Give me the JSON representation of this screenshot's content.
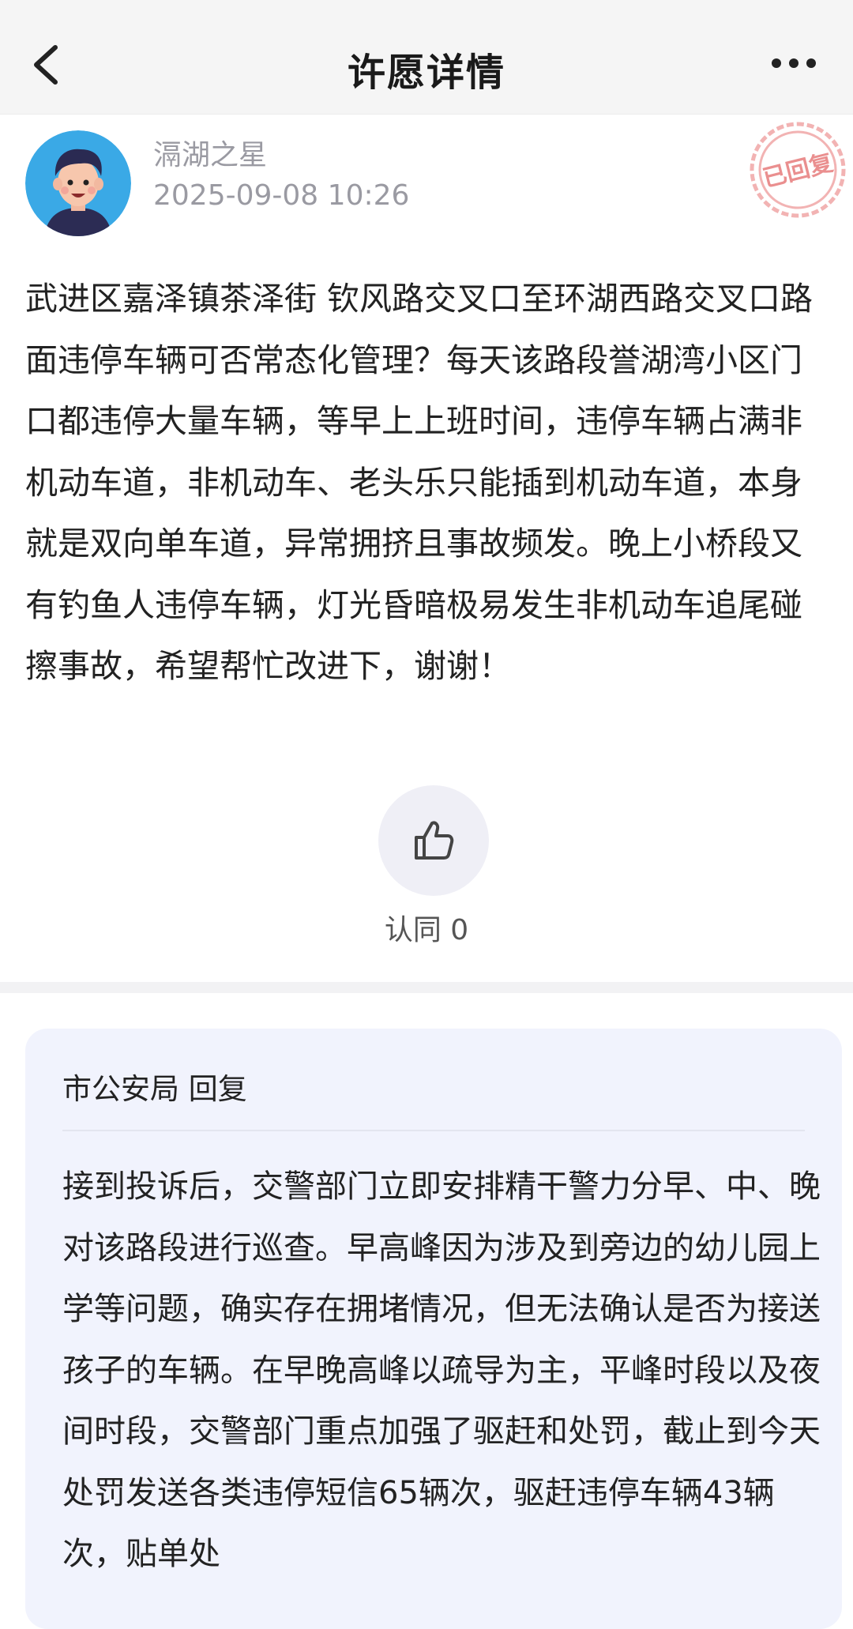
{
  "nav": {
    "title": "许愿详情",
    "back_icon": "chevron-left-icon",
    "more_icon": "more-horizontal-icon"
  },
  "author": {
    "name": "滆湖之星",
    "time": "2025-09-08 10:26",
    "stamp_text": "已回复",
    "stamp_color": "#e46a6a"
  },
  "post": {
    "content": "武进区嘉泽镇茶泽街 钦风路交叉口至环湖西路交叉口路面违停车辆可否常态化管理？每天该路段誉湖湾小区门口都违停大量车辆，等早上上班时间，违停车辆占满非机动车道，非机动车、老头乐只能插到机动车道，本身就是双向单车道，异常拥挤且事故频发。晚上小桥段又有钓鱼人违停车辆，灯光昏暗极易发生非机动车追尾碰擦事故，希望帮忙改进下，谢谢！"
  },
  "like": {
    "icon": "thumbs-up-icon",
    "label": "认同 0"
  },
  "reply": {
    "header": "市公安局 回复",
    "content": "接到投诉后，交警部门立即安排精干警力分早、中、晚对该路段进行巡查。早高峰因为涉及到旁边的幼儿园上学等问题，确实存在拥堵情况，但无法确认是否为接送孩子的车辆。在早晚高峰以疏导为主，平峰时段以及夜间时段，交警部门重点加强了驱赶和处罚，截止到今天处罚发送各类违停短信65辆次，驱赶违停车辆43辆次，贴单处"
  }
}
